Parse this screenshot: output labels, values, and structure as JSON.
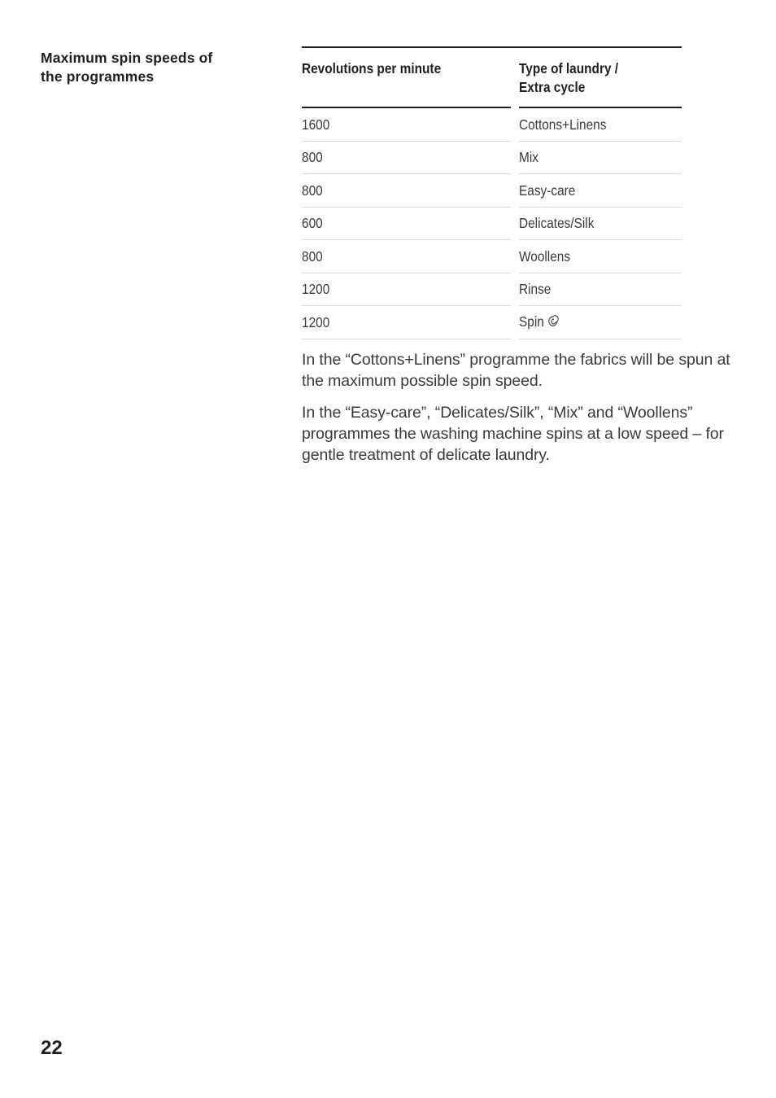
{
  "heading": {
    "line1": "Maximum spin speeds of",
    "line2": "the programmes"
  },
  "table": {
    "columns": [
      {
        "header": "Revolutions per minute",
        "header_line2": ""
      },
      {
        "header": "Type of laundry /",
        "header_line2": "Extra cycle"
      }
    ],
    "rows": [
      {
        "rpm": "1600",
        "type": "Cottons+Linens",
        "icon": ""
      },
      {
        "rpm": "800",
        "type": "Mix",
        "icon": ""
      },
      {
        "rpm": "800",
        "type": "Easy-care",
        "icon": ""
      },
      {
        "rpm": "600",
        "type": "Delicates/Silk",
        "icon": ""
      },
      {
        "rpm": "800",
        "type": "Woollens",
        "icon": ""
      },
      {
        "rpm": "1200",
        "type": "Rinse",
        "icon": ""
      },
      {
        "rpm": "1200",
        "type": "Spin",
        "icon": "spiral-spin-icon"
      }
    ]
  },
  "paragraphs": {
    "p1": "In the “Cottons+Linens” programme the fabrics will be spun at the maximum possible spin speed.",
    "p2": "In the “Easy-care”, “Delicates/Silk”, “Mix” and “Woollens” programmes the washing machine spins at a low speed – for gentle treatment of delicate laundry."
  },
  "footer": {
    "page_number": "22"
  },
  "colors": {
    "text": "#231f20",
    "body_text": "#3a3a3a",
    "rule_strong": "#231f20",
    "rule_light": "#dcdcdc",
    "background": "#ffffff"
  }
}
